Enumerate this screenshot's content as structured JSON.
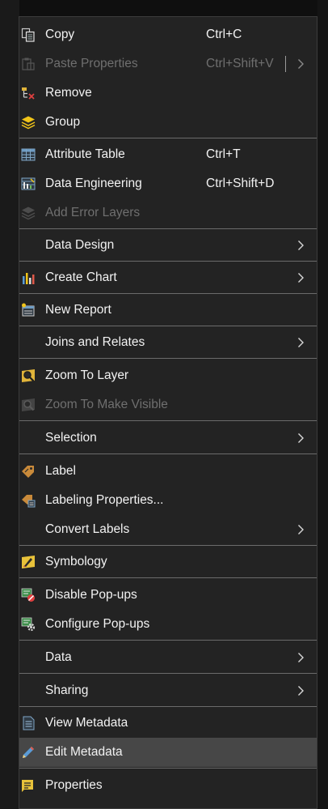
{
  "menu": {
    "items": [
      {
        "label": "Copy",
        "shortcut": "Ctrl+C"
      },
      {
        "label": "Paste Properties",
        "shortcut": "Ctrl+Shift+V"
      },
      {
        "label": "Remove"
      },
      {
        "label": "Group"
      },
      {
        "label": "Attribute Table",
        "shortcut": "Ctrl+T"
      },
      {
        "label": "Data Engineering",
        "shortcut": "Ctrl+Shift+D"
      },
      {
        "label": "Add Error Layers"
      },
      {
        "label": "Data Design"
      },
      {
        "label": "Create Chart"
      },
      {
        "label": "New Report"
      },
      {
        "label": "Joins and Relates"
      },
      {
        "label": "Zoom To Layer"
      },
      {
        "label": "Zoom To Make Visible"
      },
      {
        "label": "Selection"
      },
      {
        "label": "Label"
      },
      {
        "label": "Labeling Properties..."
      },
      {
        "label": "Convert Labels"
      },
      {
        "label": "Symbology"
      },
      {
        "label": "Disable Pop-ups"
      },
      {
        "label": "Configure Pop-ups"
      },
      {
        "label": "Data"
      },
      {
        "label": "Sharing"
      },
      {
        "label": "View Metadata"
      },
      {
        "label": "Edit Metadata"
      },
      {
        "label": "Properties"
      }
    ]
  },
  "colors": {
    "menu_background": "#232323",
    "text": "#f2f2f2",
    "disabled_text": "#6f6f6f",
    "highlight": "#474747",
    "separator": "#6b6b6b"
  }
}
